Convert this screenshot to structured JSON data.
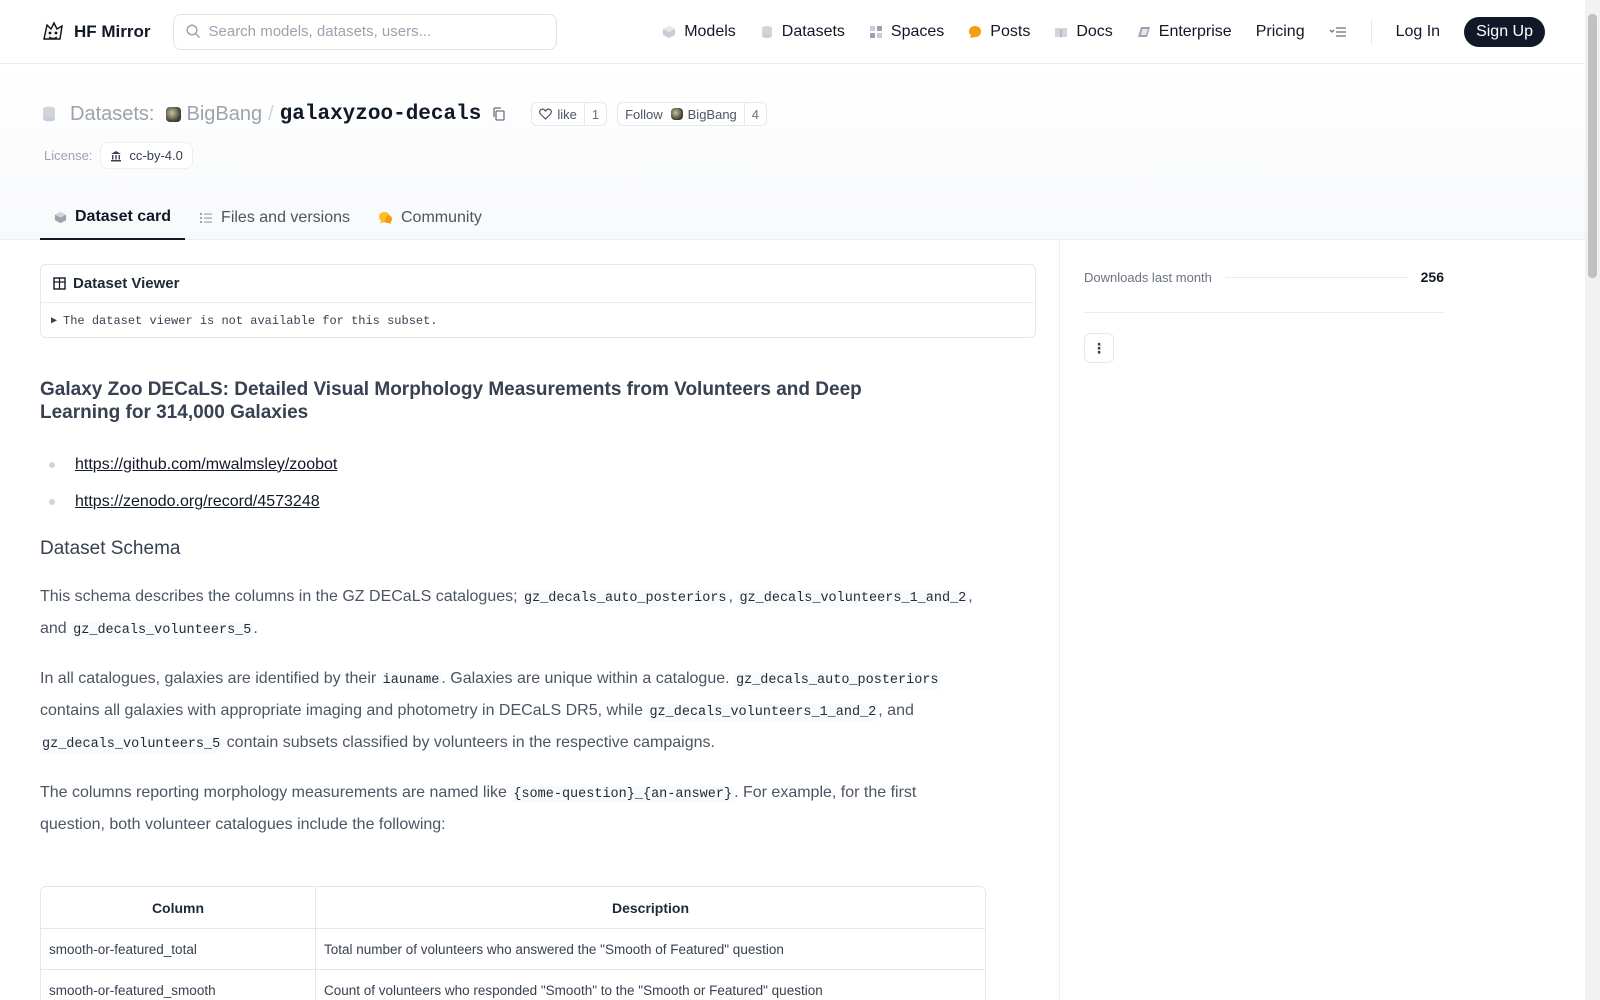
{
  "header": {
    "brand": "HF Mirror",
    "search_placeholder": "Search models, datasets, users...",
    "nav": {
      "models": "Models",
      "datasets": "Datasets",
      "spaces": "Spaces",
      "posts": "Posts",
      "docs": "Docs",
      "enterprise": "Enterprise",
      "pricing": "Pricing",
      "login": "Log In",
      "signup": "Sign Up"
    }
  },
  "dataset": {
    "section_label": "Datasets:",
    "org": "BigBang",
    "name": "galaxyzoo-decals",
    "like_label": "like",
    "like_count": "1",
    "follow_label": "Follow",
    "follow_org": "BigBang",
    "follow_count": "4",
    "license_label": "License:",
    "license": "cc-by-4.0"
  },
  "tabs": {
    "card": "Dataset card",
    "files": "Files and versions",
    "community": "Community"
  },
  "viewer": {
    "title": "Dataset Viewer",
    "message": "The dataset viewer is not available for this subset."
  },
  "content": {
    "title": "Galaxy Zoo DECaLS: Detailed Visual Morphology Measurements from Volunteers and Deep Learning for 314,000 Galaxies",
    "links": [
      "https://github.com/mwalmsley/zoobot",
      "https://zenodo.org/record/4573248"
    ],
    "schema_heading": "Dataset Schema",
    "p1": {
      "a": "This schema describes the columns in the GZ DECaLS catalogues; ",
      "c1": "gz_decals_auto_posteriors",
      "b": ", ",
      "c2": "gz_decals_volunteers_1_and_2",
      "c": ", and ",
      "c3": "gz_decals_volunteers_5",
      "d": "."
    },
    "p2": {
      "a": "In all catalogues, galaxies are identified by their ",
      "c1": "iauname",
      "b": ". Galaxies are unique within a catalogue. ",
      "c2": "gz_decals_auto_posteriors",
      "c": " contains all galaxies with appropriate imaging and photometry in DECaLS DR5, while ",
      "c3": "gz_decals_volunteers_1_and_2",
      "d": ", and ",
      "c4": "gz_decals_volunteers_5",
      "e": " contain subsets classified by volunteers in the respective campaigns."
    },
    "p3": {
      "a": "The columns reporting morphology measurements are named like ",
      "c1": "{some-question}_{an-answer}",
      "b": ". For example, for the first question, both volunteer catalogues include the following:"
    },
    "table": {
      "headers": [
        "Column",
        "Description"
      ],
      "rows": [
        [
          "smooth-or-featured_total",
          "Total number of volunteers who answered the \"Smooth of Featured\" question"
        ],
        [
          "smooth-or-featured_smooth",
          "Count of volunteers who responded \"Smooth\" to the \"Smooth or Featured\" question"
        ]
      ]
    }
  },
  "sidebar": {
    "downloads_label": "Downloads last month",
    "downloads_value": "256"
  }
}
